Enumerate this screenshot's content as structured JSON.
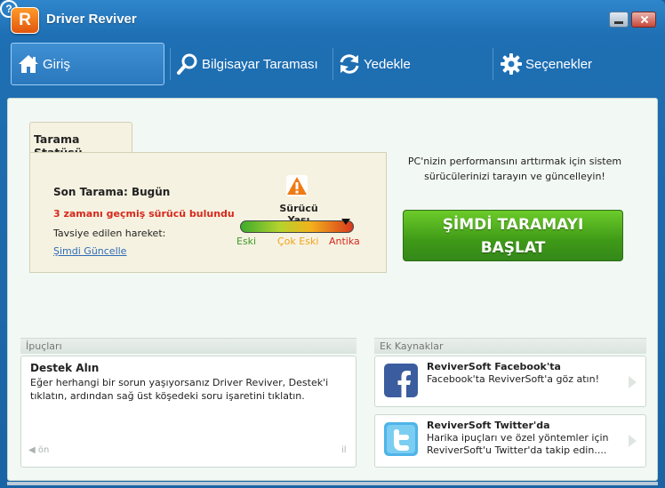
{
  "app": {
    "title": "Driver Reviver",
    "logo_letter": "R",
    "help_label": "?"
  },
  "nav": {
    "items": [
      {
        "label": "Giriş",
        "icon": "home-icon"
      },
      {
        "label": "Bilgisayar Taraması",
        "icon": "magnifier-icon"
      },
      {
        "label": "Yedekle",
        "icon": "refresh-icon"
      },
      {
        "label": "Seçenekler",
        "icon": "gear-icon"
      }
    ],
    "active_index": 0
  },
  "status": {
    "tab_label": "Tarama Statüsü",
    "last_scan": "Son Tarama: Bugün",
    "outdated": "3 zamanı geçmiş sürücü bulundu",
    "recommended": "Tavsiye edilen hareket:",
    "update_link": "Şimdi Güncelle",
    "age_label": "Sürücü Yaşı",
    "age_ticks": [
      "Eski",
      "Çok Eski",
      "Antika"
    ],
    "age_level": 0.93,
    "colors": {
      "eski": "#3b9a2a",
      "cok_eski": "#f0a31c",
      "antika": "#d6281c"
    }
  },
  "promo": {
    "text": "PC'nizin performansını arttırmak için sistem sürücülerinizi tarayın ve güncelleyin!",
    "scan_button_line1": "ŞİMDİ TARAMAYI",
    "scan_button_line2": "BAŞLAT"
  },
  "tips": {
    "header": "İpuçları",
    "title": "Destek Alın",
    "body": "Eğer herhangi bir sorun yaşıyorsanız Driver Reviver, Destek'i tıklatın, ardından sağ üst köşedeki soru işaretini tıklatın.",
    "prev_label": "ön",
    "next_label": "il"
  },
  "resources": {
    "header": "Ek Kaynaklar",
    "items": [
      {
        "title": "ReviverSoft Facebook'ta",
        "body": "Facebook'ta ReviverSoft'a göz atın!",
        "icon": "facebook-icon"
      },
      {
        "title": "ReviverSoft Twitter'da",
        "body": "Harika ipuçları ve özel yöntemler için ReviverSoft'u Twitter'da takip edin....",
        "icon": "twitter-icon"
      }
    ]
  }
}
